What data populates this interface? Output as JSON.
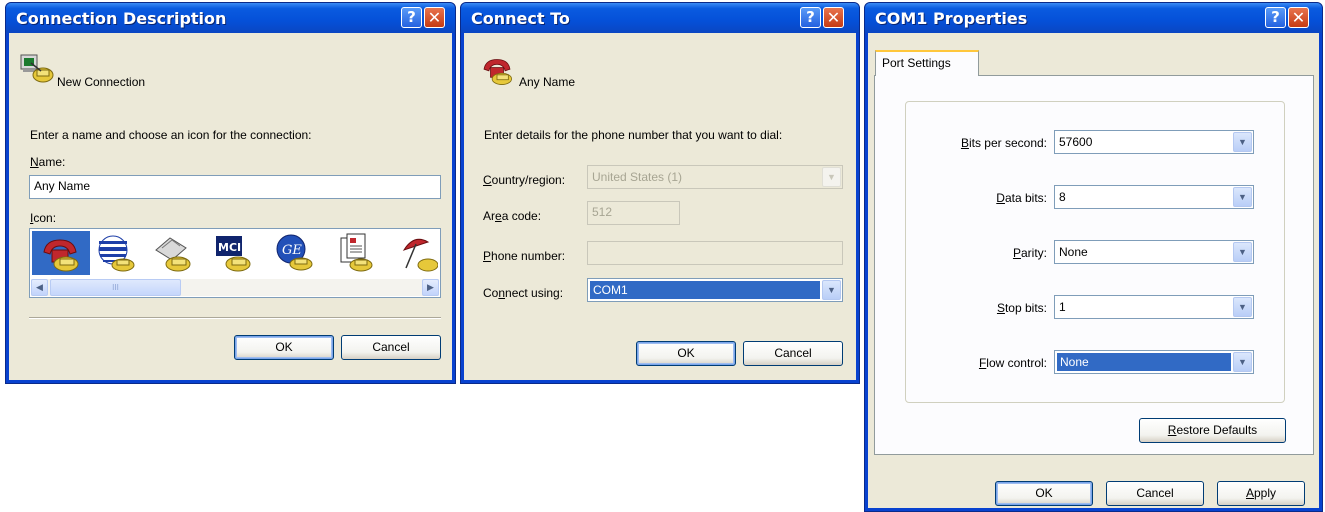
{
  "dialog1": {
    "title": "Connection Description",
    "connection_name": "New Connection",
    "instruction": "Enter a name and choose an icon for the connection:",
    "name_label": "Name:",
    "name_value": "Any Name",
    "icon_label": "Icon:",
    "icons": [
      "phone-modem-icon",
      "att-globe-icon",
      "fax-modem-icon",
      "mci-icon",
      "ge-icon",
      "documents-icon",
      "umbrella-icon"
    ],
    "ok_label": "OK",
    "cancel_label": "Cancel",
    "scroll_grip": "III"
  },
  "dialog2": {
    "title": "Connect To",
    "connection_name": "Any Name",
    "instruction": "Enter details for the phone number that you want to dial:",
    "country_label": "Country/region:",
    "country_value": "United States (1)",
    "area_label": "Area code:",
    "area_value": "512",
    "phone_label": "Phone number:",
    "phone_value": "",
    "connect_label": "Connect using:",
    "connect_value": "COM1",
    "ok_label": "OK",
    "cancel_label": "Cancel"
  },
  "dialog3": {
    "title": "COM1 Properties",
    "tab_label": "Port Settings",
    "bits_label": "Bits per second:",
    "bits_value": "57600",
    "data_label": "Data bits:",
    "data_value": "8",
    "parity_label": "Parity:",
    "parity_value": "None",
    "stop_label": "Stop bits:",
    "stop_value": "1",
    "flow_label": "Flow control:",
    "flow_value": "None",
    "restore_label": "Restore Defaults",
    "ok_label": "OK",
    "cancel_label": "Cancel",
    "apply_label": "Apply"
  },
  "titlebar_buttons": {
    "help": "?",
    "close": "✕"
  },
  "colors": {
    "titlebar": "#0550d8",
    "dialog_bg": "#ece9d8",
    "selection": "#316ac5",
    "tab_accent": "#ffc73c"
  }
}
